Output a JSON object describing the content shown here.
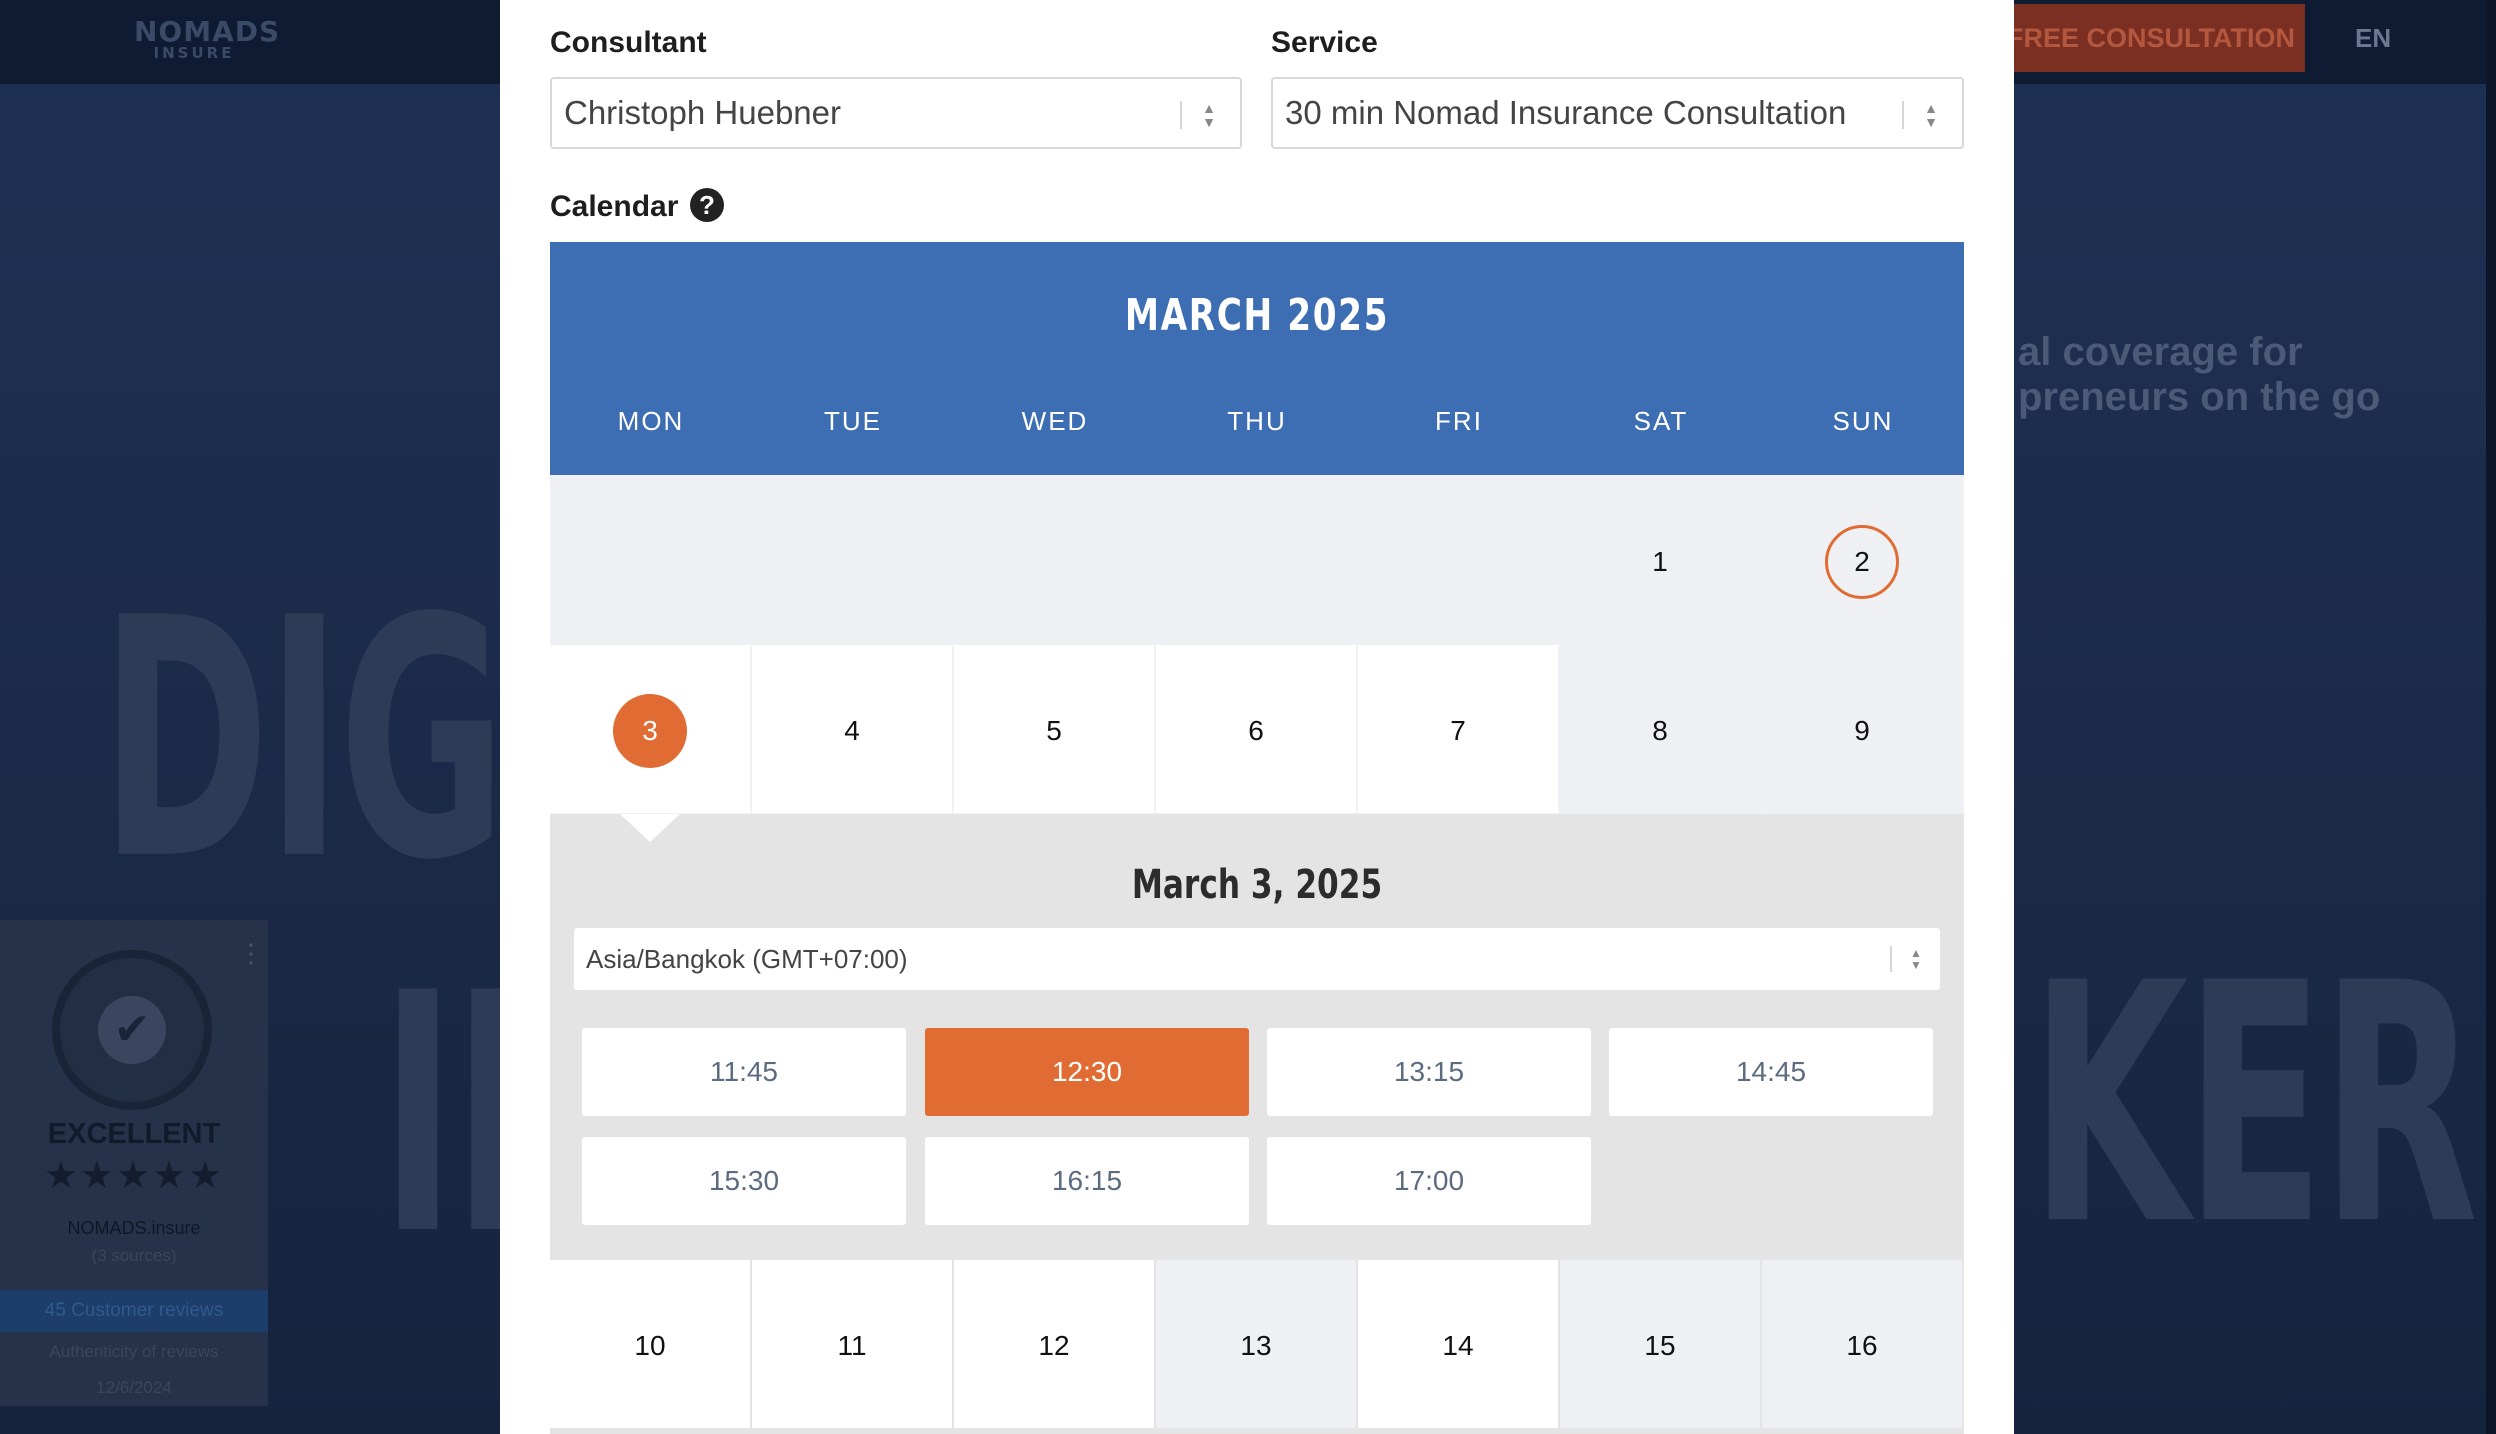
{
  "background": {
    "logo_line1": "NOMADS",
    "logo_line2": "INSURE",
    "cta_label": "FREE CONSULTATION",
    "lang": "EN",
    "headline_line1": "al coverage for",
    "headline_line2": "preneurs on the go",
    "big_text_1": "DIGI",
    "big_text_2": "IN",
    "big_text_3": "KER"
  },
  "proven_expert": {
    "rating_label": "EXCELLENT",
    "stars": "★★★★★",
    "company": "NOMADS.insure",
    "sources": "(3 sources)",
    "reviews": "45 Customer reviews",
    "authenticity": "Authenticity of reviews",
    "date": "12/6/2024"
  },
  "form": {
    "consultant_label": "Consultant",
    "consultant_value": "Christoph Huebner",
    "service_label": "Service",
    "service_value": "30 min Nomad Insurance Consultation",
    "calendar_label": "Calendar",
    "help_glyph": "?"
  },
  "calendar": {
    "month_title": "MARCH 2025",
    "weekdays": [
      "MON",
      "TUE",
      "WED",
      "THU",
      "FRI",
      "SAT",
      "SUN"
    ],
    "days": [
      "1",
      "2",
      "3",
      "4",
      "5",
      "6",
      "7",
      "8",
      "9",
      "10",
      "11",
      "12",
      "13",
      "14",
      "15",
      "16"
    ],
    "today": "2",
    "selected": "3",
    "accent_color": "#e06c34",
    "header_color": "#3d6db3"
  },
  "slots": {
    "date_title": "March 3, 2025",
    "timezone": "Asia/Bangkok (GMT+07:00)",
    "times": [
      "11:45",
      "12:30",
      "13:15",
      "14:45",
      "15:30",
      "16:15",
      "17:00"
    ],
    "selected_time": "12:30"
  }
}
